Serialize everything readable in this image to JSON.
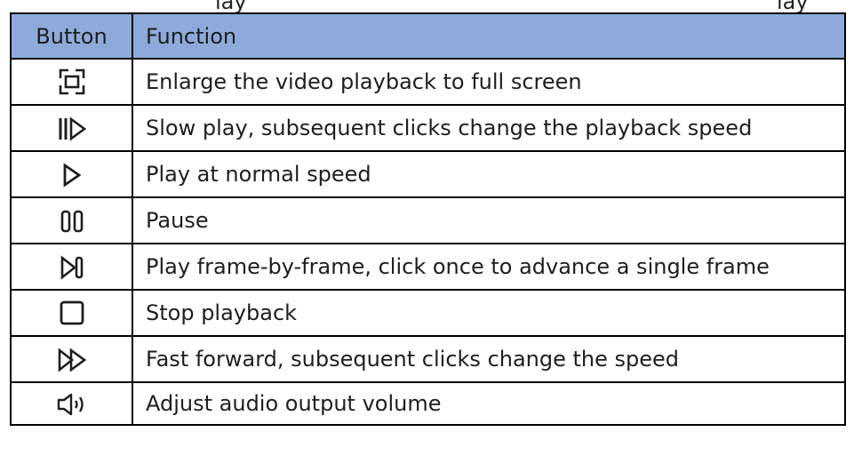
{
  "cut_line": {
    "left": "lay",
    "right": "lay"
  },
  "table": {
    "headers": {
      "button": "Button",
      "function": "Function"
    },
    "rows": [
      {
        "icon": "fullscreen-icon",
        "description": "Enlarge the video playback to full screen"
      },
      {
        "icon": "slow-play-icon",
        "description": "Slow play, subsequent clicks change the playback speed"
      },
      {
        "icon": "play-icon",
        "description": "Play at normal speed"
      },
      {
        "icon": "pause-icon",
        "description": "Pause"
      },
      {
        "icon": "frame-step-icon",
        "description": "Play frame-by-frame, click once to advance a single frame"
      },
      {
        "icon": "stop-icon",
        "description": "Stop playback"
      },
      {
        "icon": "fast-forward-icon",
        "description": "Fast forward, subsequent clicks change the speed"
      },
      {
        "icon": "volume-icon",
        "description": "Adjust audio output volume"
      }
    ]
  }
}
